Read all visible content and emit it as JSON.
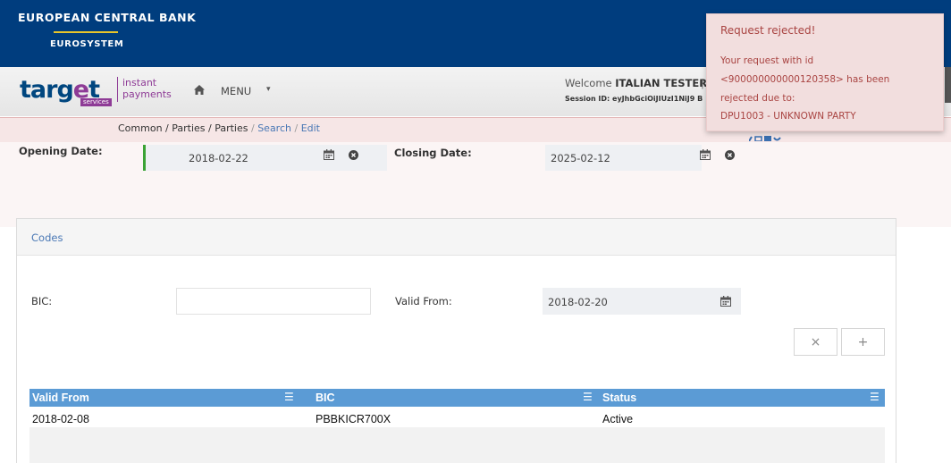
{
  "header": {
    "bank_name": "EUROPEAN CENTRAL BANK",
    "eurosystem": "EUROSYSTEM"
  },
  "nav": {
    "logo_main_a": "targ",
    "logo_main_e": "e",
    "logo_main_b": "t",
    "logo_services": "services",
    "logo_instant": "instant",
    "logo_payments": "payments",
    "menu_label": "MENU",
    "welcome_prefix": "Welcome",
    "welcome_user": "ITALIAN TESTER",
    "welcome_sep": "|",
    "session_text": "Session ID: eyJhbGciOiJIUzI1NiJ9  B"
  },
  "breadcrumb": {
    "path": "Common / Parties / Parties",
    "sep1": " / ",
    "search": "Search",
    "sep2": " / ",
    "edit": "Edit"
  },
  "form": {
    "opening_label": "Opening Date:",
    "opening_value": "2018-02-22",
    "closing_label": "Closing Date:",
    "closing_value": "2025-02-12"
  },
  "codes": {
    "title": "Codes",
    "bic_label": "BIC:",
    "bic_value": "",
    "valid_from_label": "Valid From:",
    "valid_from_value": "2018-02-20",
    "clear_symbol": "×",
    "add_symbol": "+"
  },
  "table": {
    "columns": [
      "Valid From",
      "BIC",
      "Status"
    ],
    "menu_symbol": "☰",
    "rows": [
      {
        "valid_from": "2018-02-08",
        "bic": "PBBKICR700X",
        "status": "Active"
      }
    ]
  },
  "toast": {
    "title": "Request rejected!",
    "line1": "Your request with id",
    "line2": "<900000000000120358> has been",
    "line3": "rejected due to:",
    "line4": "DPU1003 - UNKNOWN PARTY"
  },
  "colors": {
    "ecb_blue": "#003d7e",
    "target_purple": "#8e3b96",
    "table_header": "#5b9bd5",
    "error_bg": "#f2dede",
    "error_text": "#a94442"
  }
}
